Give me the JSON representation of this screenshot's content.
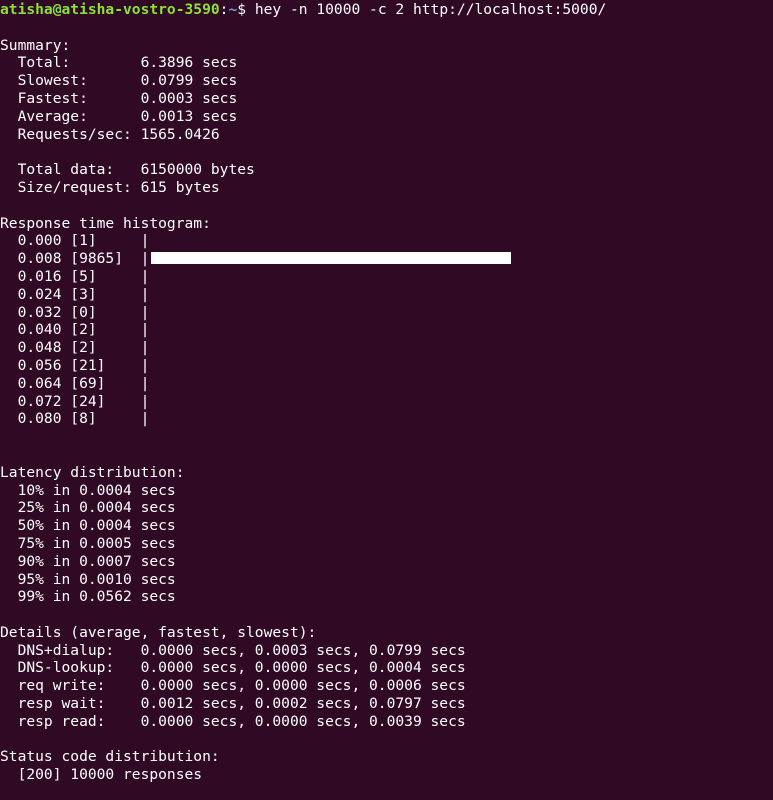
{
  "prompt": {
    "user_host": "atisha@atisha-vostro-3590",
    "separator": ":",
    "path": "~",
    "symbol": "$",
    "command": " hey -n 10000 -c 2 http://localhost:5000/"
  },
  "summary": {
    "heading": "Summary:",
    "rows": [
      "  Total:        6.3896 secs",
      "  Slowest:      0.0799 secs",
      "  Fastest:      0.0003 secs",
      "  Average:      0.0013 secs",
      "  Requests/sec: 1565.0426"
    ],
    "data_rows": [
      "  Total data:   6150000 bytes",
      "  Size/request: 615 bytes"
    ]
  },
  "histogram": {
    "heading": "Response time histogram:",
    "rows": [
      {
        "label": "  0.000 [1]     |",
        "count": 1
      },
      {
        "label": "  0.008 [9865]  |",
        "count": 9865
      },
      {
        "label": "  0.016 [5]     |",
        "count": 5
      },
      {
        "label": "  0.024 [3]     |",
        "count": 3
      },
      {
        "label": "  0.032 [0]     |",
        "count": 0
      },
      {
        "label": "  0.040 [2]     |",
        "count": 2
      },
      {
        "label": "  0.048 [2]     |",
        "count": 2
      },
      {
        "label": "  0.056 [21]    |",
        "count": 21
      },
      {
        "label": "  0.064 [69]    |",
        "count": 69
      },
      {
        "label": "  0.072 [24]    |",
        "count": 24
      },
      {
        "label": "  0.080 [8]     |",
        "count": 8
      }
    ]
  },
  "latency": {
    "heading": "Latency distribution:",
    "rows": [
      "  10% in 0.0004 secs",
      "  25% in 0.0004 secs",
      "  50% in 0.0004 secs",
      "  75% in 0.0005 secs",
      "  90% in 0.0007 secs",
      "  95% in 0.0010 secs",
      "  99% in 0.0562 secs"
    ]
  },
  "details": {
    "heading": "Details (average, fastest, slowest):",
    "rows": [
      "  DNS+dialup:   0.0000 secs, 0.0003 secs, 0.0799 secs",
      "  DNS-lookup:   0.0000 secs, 0.0000 secs, 0.0004 secs",
      "  req write:    0.0000 secs, 0.0000 secs, 0.0006 secs",
      "  resp wait:    0.0012 secs, 0.0002 secs, 0.0797 secs",
      "  resp read:    0.0000 secs, 0.0000 secs, 0.0039 secs"
    ]
  },
  "status": {
    "heading": "Status code distribution:",
    "rows": [
      "  [200] 10000 responses"
    ]
  },
  "colors": {
    "background": "#300a24",
    "text": "#ffffff",
    "user_host": "#8ae234",
    "path": "#729fcf"
  }
}
